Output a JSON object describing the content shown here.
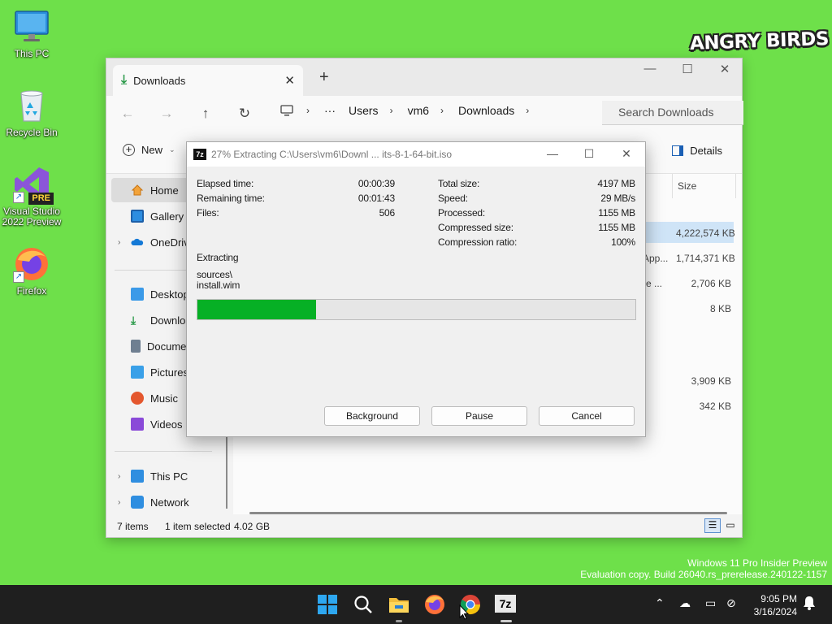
{
  "desktop": {
    "icons": [
      {
        "label": "This PC"
      },
      {
        "label": "Recycle Bin"
      },
      {
        "label": "Visual Studio 2022 Preview",
        "badge": "PRE"
      },
      {
        "label": "Firefox"
      }
    ],
    "logo_text": "ANGRY BIRDS",
    "watermark": {
      "line1": "Windows 11 Pro Insider Preview",
      "line2": "Evaluation copy. Build 26040.rs_prerelease.240122-1157"
    }
  },
  "explorer": {
    "tab_title": "Downloads",
    "breadcrumb": [
      "Users",
      "vm6",
      "Downloads"
    ],
    "search_placeholder": "Search Downloads",
    "new_label": "New",
    "details_label": "Details",
    "nav": {
      "home": "Home",
      "gallery": "Gallery",
      "onedrive": "OneDrive",
      "desktop": "Desktop",
      "downloads": "Downloads",
      "documents": "Documents",
      "pictures": "Pictures",
      "music": "Music",
      "videos": "Videos",
      "thispc": "This PC",
      "network": "Network"
    },
    "size_header": "Size",
    "rows": [
      {
        "type": "",
        "size": "4,222,574 KB"
      },
      {
        "type": "App...",
        "size": "1,714,371 KB"
      },
      {
        "type": "e ...",
        "size": "2,706 KB"
      },
      {
        "type": "",
        "size": "8 KB"
      },
      {
        "type": "",
        "size": "3,909 KB"
      },
      {
        "type": "",
        "size": "342 KB"
      }
    ],
    "status": {
      "items": "7 items",
      "selected": "1 item selected",
      "selsize": "4.02 GB"
    }
  },
  "dialog": {
    "title": "27% Extracting C:\\Users\\vm6\\Downl ... its-8-1-64-bit.iso",
    "icon_text": "7z",
    "left": [
      {
        "label": "Elapsed time:",
        "value": "00:00:39"
      },
      {
        "label": "Remaining time:",
        "value": "00:01:43"
      },
      {
        "label": "Files:",
        "value": "506"
      }
    ],
    "right": [
      {
        "label": "Total size:",
        "value": "4197 MB"
      },
      {
        "label": "Speed:",
        "value": "29 MB/s"
      },
      {
        "label": "Processed:",
        "value": "1155 MB"
      },
      {
        "label": "Compressed size:",
        "value": "1155 MB"
      },
      {
        "label": "Compression ratio:",
        "value": "100%"
      }
    ],
    "status": "Extracting",
    "path_line1": "sources\\",
    "path_line2": "install.wim",
    "progress_percent": 27,
    "buttons": {
      "background": "Background",
      "pause": "Pause",
      "cancel": "Cancel"
    },
    "progress_color": "#06b025"
  },
  "taskbar": {
    "time": "9:05 PM",
    "date": "3/16/2024",
    "icon_7z": "7z"
  }
}
